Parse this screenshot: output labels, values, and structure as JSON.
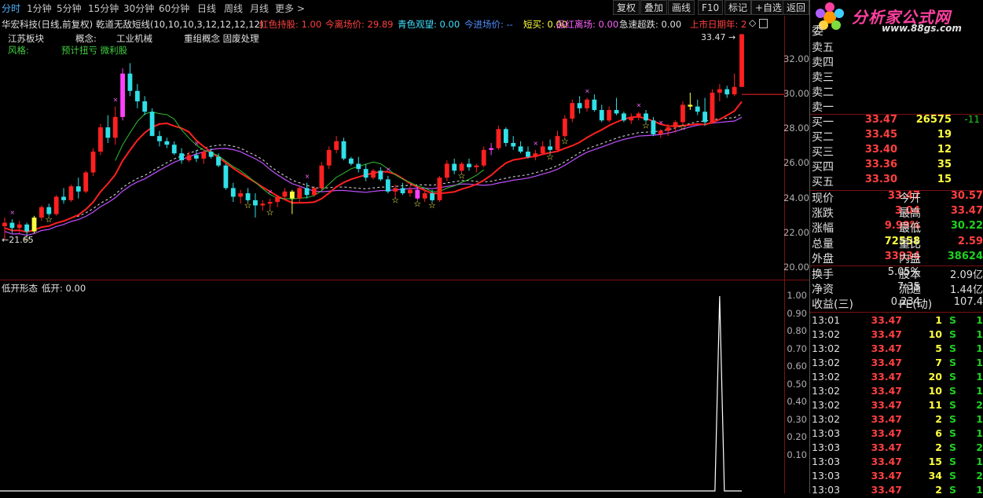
{
  "toolbar": {
    "periods": [
      "分时",
      "1分钟",
      "5分钟",
      "15分钟",
      "30分钟",
      "60分钟",
      "日线",
      "周线",
      "月线",
      "更多 >"
    ],
    "active_period": "分时",
    "buttons": [
      "复权",
      "叠加",
      "画线",
      "F10",
      "标记",
      "+自选",
      "返回"
    ]
  },
  "logo": {
    "text": "分析家公式网",
    "url": "www.88gs.com"
  },
  "header": {
    "title": "华宏科技(日线,前复权)",
    "formula": "乾道无敌短线(10,10,10,3,12,12,12,12)",
    "indicators": [
      {
        "label": "红色持股: 1.00",
        "color": "#ff4040"
      },
      {
        "label": "今离场价: 29.89",
        "color": "#ff4040"
      },
      {
        "label": "青色观望: 0.00",
        "color": "#40e0ff"
      },
      {
        "label": "今进场价: --",
        "color": "#4f8fff"
      },
      {
        "label": "短买: 0.00",
        "color": "#ffff40"
      },
      {
        "label": "品红离场: 0.00",
        "color": "#ff60ff"
      },
      {
        "label": "急速超跌: 0.00",
        "color": "#e0e0e0"
      },
      {
        "label": "上市日期年: 2",
        "color": "#ff4040"
      }
    ],
    "board_label": "江苏板块",
    "concept_label": "概念:",
    "concept_value": "工业机械",
    "restructure_label": "重组概念 固废处理",
    "style_label": "风格:",
    "style_value": "预计扭亏 微利股"
  },
  "main_chart": {
    "price_ticks": [
      "32.00",
      "30.00",
      "28.00",
      "26.00",
      "24.00",
      "22.00",
      "20.00"
    ],
    "max_label": "33.47",
    "min_label": "21.65"
  },
  "sub_chart": {
    "title": "低开形态",
    "value_label": "低开: 0.00",
    "ticks": [
      "1.00",
      "0.90",
      "0.80",
      "0.70",
      "0.60",
      "0.50",
      "0.40",
      "0.30",
      "0.20",
      "0.10"
    ]
  },
  "chart_data": {
    "type": "candlestick",
    "title": "华宏科技(日线,前复权)",
    "ylim": [
      19.8,
      33.8
    ],
    "candles": [
      [
        22.4,
        22.9,
        21.65,
        22.6
      ],
      [
        22.6,
        22.8,
        22.0,
        22.3
      ],
      [
        22.3,
        22.7,
        22.0,
        22.5
      ],
      [
        22.5,
        22.6,
        21.9,
        22.1
      ],
      [
        22.1,
        23.0,
        22.0,
        22.9
      ],
      [
        22.9,
        23.6,
        22.7,
        23.5
      ],
      [
        23.5,
        23.7,
        23.0,
        23.1
      ],
      [
        23.1,
        24.2,
        23.0,
        24.1
      ],
      [
        24.1,
        24.6,
        23.7,
        23.9
      ],
      [
        23.9,
        24.8,
        23.8,
        24.7
      ],
      [
        24.7,
        25.2,
        24.0,
        24.4
      ],
      [
        24.4,
        25.6,
        24.3,
        25.5
      ],
      [
        25.5,
        26.9,
        25.3,
        26.7
      ],
      [
        26.7,
        28.3,
        26.5,
        28.1
      ],
      [
        28.1,
        28.8,
        27.2,
        27.5
      ],
      [
        27.5,
        29.3,
        27.1,
        28.7
      ],
      [
        28.7,
        31.5,
        28.5,
        31.2
      ],
      [
        31.2,
        31.8,
        29.9,
        30.2
      ],
      [
        30.2,
        30.6,
        29.2,
        29.6
      ],
      [
        29.6,
        29.9,
        28.8,
        29.0
      ],
      [
        29.0,
        29.2,
        27.6,
        27.6
      ],
      [
        27.6,
        27.9,
        27.0,
        27.3
      ],
      [
        27.3,
        27.5,
        26.9,
        27.1
      ],
      [
        27.1,
        27.3,
        26.5,
        26.6
      ],
      [
        26.6,
        26.9,
        26.0,
        26.2
      ],
      [
        26.2,
        26.7,
        26.1,
        26.5
      ],
      [
        26.5,
        26.8,
        26.1,
        26.3
      ],
      [
        26.3,
        26.8,
        26.0,
        26.7
      ],
      [
        26.7,
        26.9,
        26.3,
        26.4
      ],
      [
        26.4,
        26.6,
        25.8,
        25.9
      ],
      [
        25.9,
        26.0,
        24.5,
        24.6
      ],
      [
        24.6,
        24.9,
        23.8,
        24.1
      ],
      [
        24.1,
        24.5,
        23.7,
        24.3
      ],
      [
        24.3,
        24.6,
        23.8,
        23.9
      ],
      [
        23.9,
        24.3,
        22.9,
        23.6
      ],
      [
        23.6,
        23.9,
        23.3,
        23.7
      ],
      [
        23.7,
        24.0,
        23.4,
        23.8
      ],
      [
        23.8,
        24.2,
        23.5,
        24.1
      ],
      [
        24.1,
        24.6,
        23.9,
        24.4
      ],
      [
        24.4,
        24.5,
        23.1,
        24.0
      ],
      [
        24.0,
        24.7,
        23.8,
        24.6
      ],
      [
        24.6,
        24.9,
        24.0,
        24.2
      ],
      [
        24.2,
        24.7,
        24.1,
        24.6
      ],
      [
        24.6,
        26.1,
        24.5,
        25.9
      ],
      [
        25.9,
        27.0,
        25.7,
        26.8
      ],
      [
        26.8,
        27.6,
        26.6,
        27.3
      ],
      [
        27.3,
        27.5,
        26.2,
        26.3
      ],
      [
        26.3,
        26.4,
        25.9,
        26.0
      ],
      [
        26.0,
        26.4,
        25.5,
        25.7
      ],
      [
        25.7,
        26.0,
        25.0,
        25.2
      ],
      [
        25.2,
        25.7,
        25.1,
        25.6
      ],
      [
        25.6,
        25.8,
        25.0,
        25.1
      ],
      [
        25.1,
        25.3,
        24.3,
        24.4
      ],
      [
        24.4,
        24.8,
        24.1,
        24.6
      ],
      [
        24.6,
        24.9,
        24.2,
        24.3
      ],
      [
        24.3,
        24.7,
        24.1,
        24.5
      ],
      [
        24.5,
        24.7,
        23.9,
        24.0
      ],
      [
        24.0,
        24.5,
        23.8,
        24.3
      ],
      [
        24.3,
        24.5,
        23.8,
        23.9
      ],
      [
        23.9,
        25.3,
        23.8,
        25.2
      ],
      [
        25.2,
        26.2,
        25.0,
        26.0
      ],
      [
        26.0,
        26.3,
        25.4,
        25.6
      ],
      [
        25.6,
        26.1,
        25.5,
        26.0
      ],
      [
        26.0,
        26.3,
        25.6,
        25.8
      ],
      [
        25.8,
        26.0,
        25.5,
        25.9
      ],
      [
        25.9,
        27.0,
        25.8,
        26.8
      ],
      [
        26.8,
        27.2,
        26.5,
        26.9
      ],
      [
        26.9,
        28.2,
        26.8,
        28.0
      ],
      [
        28.0,
        28.1,
        27.0,
        27.2
      ],
      [
        27.2,
        27.6,
        26.8,
        27.0
      ],
      [
        27.0,
        27.3,
        26.6,
        26.7
      ],
      [
        26.7,
        27.0,
        26.3,
        26.4
      ],
      [
        26.4,
        26.8,
        26.2,
        26.6
      ],
      [
        26.6,
        27.3,
        26.5,
        27.0
      ],
      [
        27.0,
        27.4,
        26.6,
        26.8
      ],
      [
        26.8,
        27.9,
        26.7,
        27.6
      ],
      [
        27.6,
        28.8,
        27.5,
        28.6
      ],
      [
        28.6,
        29.7,
        28.4,
        29.5
      ],
      [
        29.5,
        29.9,
        28.9,
        29.2
      ],
      [
        29.2,
        29.8,
        29.0,
        29.7
      ],
      [
        29.7,
        30.0,
        29.0,
        29.1
      ],
      [
        29.1,
        29.4,
        28.4,
        28.5
      ],
      [
        28.5,
        29.3,
        28.4,
        29.1
      ],
      [
        29.1,
        29.8,
        28.8,
        28.9
      ],
      [
        28.9,
        29.0,
        28.4,
        28.5
      ],
      [
        28.5,
        28.9,
        28.3,
        28.7
      ],
      [
        28.7,
        29.0,
        28.5,
        28.9
      ],
      [
        28.9,
        29.1,
        28.4,
        28.5
      ],
      [
        28.5,
        28.7,
        27.6,
        27.7
      ],
      [
        27.7,
        28.0,
        27.5,
        27.9
      ],
      [
        27.9,
        28.3,
        27.6,
        28.1
      ],
      [
        28.1,
        28.5,
        27.8,
        28.4
      ],
      [
        28.4,
        29.6,
        28.3,
        29.4
      ],
      [
        29.4,
        30.1,
        29.1,
        29.3
      ],
      [
        29.3,
        29.7,
        28.8,
        29.0
      ],
      [
        29.0,
        29.8,
        28.2,
        28.4
      ],
      [
        28.4,
        30.3,
        28.3,
        30.1
      ],
      [
        30.1,
        30.6,
        29.6,
        30.3
      ],
      [
        30.3,
        30.5,
        29.8,
        30.0
      ],
      [
        30.0,
        31.2,
        29.9,
        30.43
      ],
      [
        30.43,
        33.47,
        30.43,
        33.47
      ]
    ],
    "sub_values": {
      "index": 97,
      "value": 1.0
    }
  },
  "order_book": {
    "header": "委",
    "asks": [
      {
        "label": "卖五",
        "price": "",
        "vol": ""
      },
      {
        "label": "卖四",
        "price": "",
        "vol": ""
      },
      {
        "label": "卖三",
        "price": "",
        "vol": ""
      },
      {
        "label": "卖二",
        "price": "",
        "vol": ""
      },
      {
        "label": "卖一",
        "price": "",
        "vol": ""
      }
    ],
    "bids": [
      {
        "label": "买一",
        "price": "33.47",
        "vol": "26575",
        "chg": "-11"
      },
      {
        "label": "买二",
        "price": "33.45",
        "vol": "19",
        "chg": ""
      },
      {
        "label": "买三",
        "price": "33.40",
        "vol": "12",
        "chg": ""
      },
      {
        "label": "买四",
        "price": "33.36",
        "vol": "35",
        "chg": ""
      },
      {
        "label": "买五",
        "price": "33.30",
        "vol": "15",
        "chg": ""
      }
    ]
  },
  "quote": [
    {
      "l1": "现价",
      "v1": "33.47",
      "c1": "red",
      "l2": "今开",
      "v2": "30.57",
      "c2": "red"
    },
    {
      "l1": "涨跌",
      "v1": "3.04",
      "c1": "red",
      "l2": "最高",
      "v2": "33.47",
      "c2": "red"
    },
    {
      "l1": "涨幅",
      "v1": "9.99%",
      "c1": "red",
      "l2": "最低",
      "v2": "30.22",
      "c2": "green"
    },
    {
      "l1": "总量",
      "v1": "72558",
      "c1": "yellow",
      "l2": "量比",
      "v2": "2.59",
      "c2": "red"
    },
    {
      "l1": "外盘",
      "v1": "33934",
      "c1": "red",
      "l2": "内盘",
      "v2": "38624",
      "c2": "green"
    },
    {
      "l1": "换手",
      "v1": "5.05%",
      "c1": "white",
      "l2": "股本",
      "v2": "2.09亿",
      "c2": "white"
    },
    {
      "l1": "净资",
      "v1": "7.35",
      "c1": "white",
      "l2": "流通",
      "v2": "1.44亿",
      "c2": "white"
    },
    {
      "l1": "收益(三)",
      "v1": "0.234",
      "c1": "white",
      "l2": "PE(动)",
      "v2": "107.4",
      "c2": "white"
    }
  ],
  "ticks": [
    {
      "t": "13:01",
      "p": "33.47",
      "v": "1",
      "s": "S",
      "n": "1"
    },
    {
      "t": "13:02",
      "p": "33.47",
      "v": "10",
      "s": "S",
      "n": "1"
    },
    {
      "t": "13:02",
      "p": "33.47",
      "v": "5",
      "s": "S",
      "n": "1"
    },
    {
      "t": "13:02",
      "p": "33.47",
      "v": "7",
      "s": "S",
      "n": "1"
    },
    {
      "t": "13:02",
      "p": "33.47",
      "v": "20",
      "s": "S",
      "n": "1"
    },
    {
      "t": "13:02",
      "p": "33.47",
      "v": "10",
      "s": "S",
      "n": "1"
    },
    {
      "t": "13:02",
      "p": "33.47",
      "v": "11",
      "s": "S",
      "n": "2"
    },
    {
      "t": "13:02",
      "p": "33.47",
      "v": "2",
      "s": "S",
      "n": "1"
    },
    {
      "t": "13:03",
      "p": "33.47",
      "v": "6",
      "s": "S",
      "n": "1"
    },
    {
      "t": "13:03",
      "p": "33.47",
      "v": "2",
      "s": "S",
      "n": "2"
    },
    {
      "t": "13:03",
      "p": "33.47",
      "v": "15",
      "s": "S",
      "n": "1"
    },
    {
      "t": "13:03",
      "p": "33.47",
      "v": "34",
      "s": "S",
      "n": "2"
    },
    {
      "t": "13:03",
      "p": "33.47",
      "v": "2",
      "s": "S",
      "n": "1"
    }
  ]
}
